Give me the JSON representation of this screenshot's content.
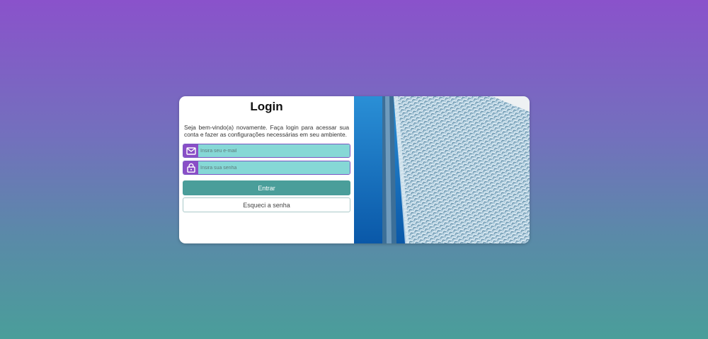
{
  "login": {
    "title": "Login",
    "description": "Seja bem-vindo(a) novamente. Faça login para acessar sua conta e fazer as configurações necessárias em seu ambiente.",
    "email_placeholder": "Insira seu e-mail",
    "password_placeholder": "Insira sua senha",
    "submit_label": "Entrar",
    "forgot_label": "Esqueci a senha"
  },
  "icons": {
    "email": "envelope-icon",
    "password": "lock-icon"
  },
  "colors": {
    "gradient_top": "#8a52cb",
    "gradient_bottom": "#4a9e9a",
    "accent_purple": "#8a4ec7",
    "input_fill": "#86d8d6",
    "button_teal": "#4a9e9a"
  }
}
